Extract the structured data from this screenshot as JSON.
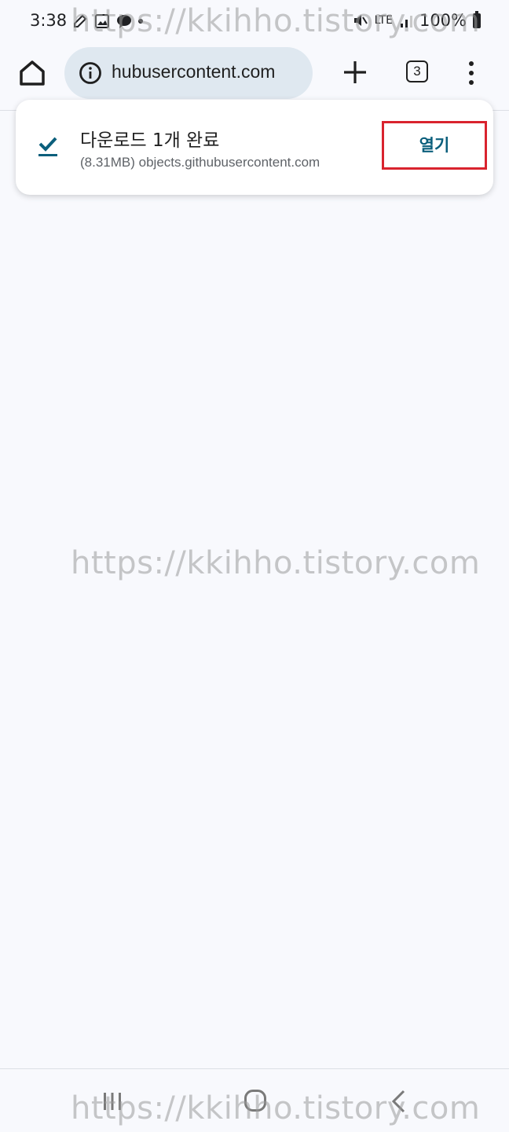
{
  "status_bar": {
    "time": "3:38",
    "network": "LTE",
    "battery": "100%"
  },
  "toolbar": {
    "url": "hubusercontent.com",
    "tab_count": "3"
  },
  "download": {
    "title": "다운로드 1개 완료",
    "detail": "(8.31MB) objects.githubusercontent.com",
    "open_label": "열기",
    "highlight_color": "#d9232e"
  },
  "watermark": {
    "text": "https://kkihho.tistory.com"
  },
  "colors": {
    "accent": "#0b5f7c",
    "background": "#f8f9fd",
    "omnibox": "#dfe8f0"
  }
}
